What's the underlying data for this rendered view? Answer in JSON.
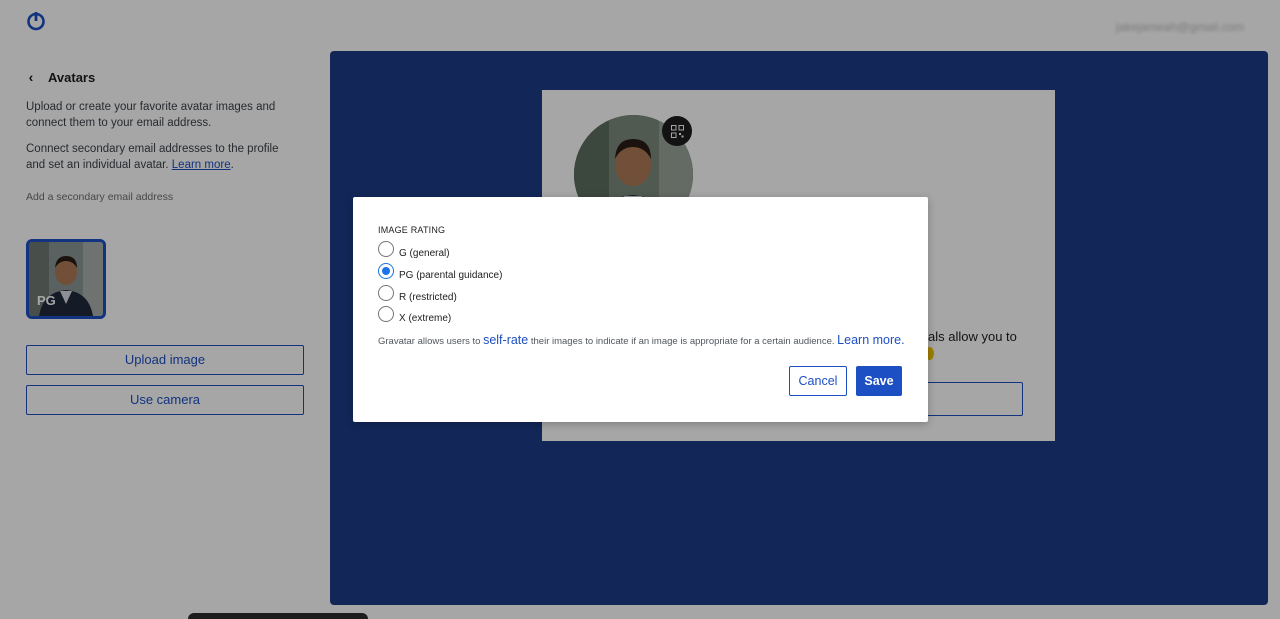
{
  "header": {
    "logo_icon": "gravatar-power-icon",
    "account_email": "jakejameah@gmail.com",
    "account_caret_icon": "chevron-down-icon"
  },
  "sidebar": {
    "back_icon": "chevron-left-icon",
    "title": "Avatars",
    "intro": "Upload or create your favorite avatar images and connect them to your email address.",
    "connect_text": "Connect secondary email addresses to the profile and set an individual avatar.",
    "connect_link": "Learn more",
    "connect_suffix": ".",
    "add_secondary": "Add a secondary email address",
    "avatar_rating_badge": "PG",
    "upload_label": "Upload image",
    "camera_label": "Use camera"
  },
  "profile_card": {
    "qr_icon": "qr-code-icon",
    "partial_text": "als allow you to"
  },
  "modal": {
    "title": "IMAGE RATING",
    "options": [
      {
        "label": "G (general)",
        "checked": false
      },
      {
        "label": "PG (parental guidance)",
        "checked": true
      },
      {
        "label": "R (restricted)",
        "checked": false
      },
      {
        "label": "X (extreme)",
        "checked": false
      }
    ],
    "explain_prefix": "Gravatar allows users to",
    "explain_link": "self-rate",
    "explain_suffix": "their images to indicate if an image is appropriate for a certain audience.",
    "learn_more": "Learn more.",
    "cancel_label": "Cancel",
    "save_label": "Save"
  },
  "colors": {
    "accent": "#1d4fc4",
    "panel": "#1d3c87",
    "radio_checked": "#1a73e8"
  }
}
